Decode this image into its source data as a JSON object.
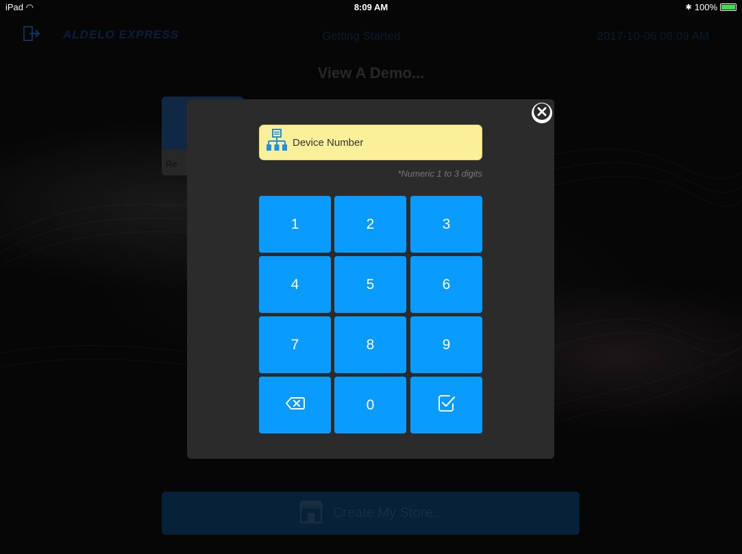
{
  "status_bar": {
    "device": "iPad",
    "time": "8:09 AM",
    "battery": "100%"
  },
  "header": {
    "brand": "ALDELO EXPRESS",
    "title": "Getting Started",
    "datetime": "2017-10-06 08:09 AM"
  },
  "demo": {
    "title": "View A Demo...",
    "card_label": "Re"
  },
  "create_store": {
    "label": "Create My Store..."
  },
  "modal": {
    "field_label": "Device Number",
    "hint": "*Numeric 1 to 3 digits",
    "keys": {
      "k1": "1",
      "k2": "2",
      "k3": "3",
      "k4": "4",
      "k5": "5",
      "k6": "6",
      "k7": "7",
      "k8": "8",
      "k9": "9",
      "k0": "0"
    },
    "icons": {
      "close": "close-icon",
      "field": "network-icon",
      "backspace": "backspace-icon",
      "confirm": "checkbox-check-icon"
    }
  },
  "colors": {
    "key_blue": "#0a9bff",
    "field_yellow": "#fbf09a",
    "modal_bg": "#2b2b2b"
  }
}
